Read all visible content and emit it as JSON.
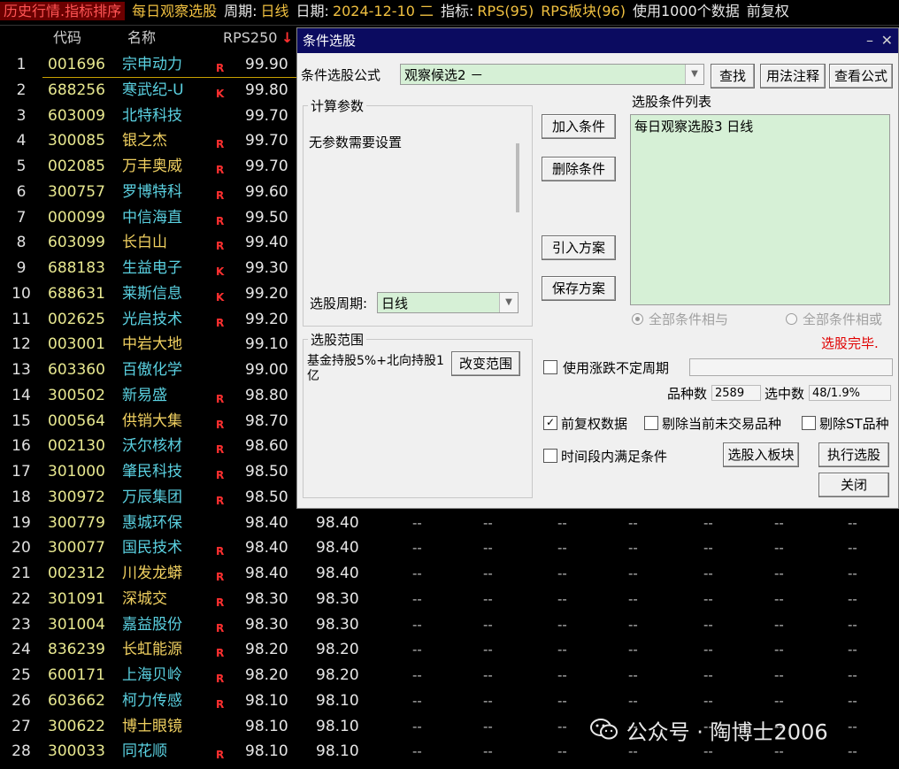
{
  "topbar": {
    "title": "历史行情.指标排序",
    "formula": "每日观察选股",
    "period_label": "周期:",
    "period_value": "日线",
    "date_label": "日期:",
    "date_value": "2024-12-10 二",
    "indicator_label": "指标:",
    "indicator_value": "RPS(95)",
    "sector_value": "RPS板块(96)",
    "data_note": "使用1000个数据",
    "adjust": "前复权"
  },
  "table": {
    "headers": {
      "code": "代码",
      "name": "名称",
      "rps": "RPS250",
      "sort_icon": "↓"
    },
    "rows": [
      {
        "idx": "1",
        "code": "001696",
        "name": "宗申动力",
        "flag": "R",
        "rps": "99.90",
        "rps2": "",
        "name_color": "#5ad0e0"
      },
      {
        "idx": "2",
        "code": "688256",
        "name": "寒武纪-U",
        "flag": "K",
        "rps": "99.80",
        "rps2": "",
        "name_color": "#5ad0e0"
      },
      {
        "idx": "3",
        "code": "603009",
        "name": "北特科技",
        "flag": "",
        "rps": "99.70",
        "rps2": "",
        "name_color": "#5ad0e0"
      },
      {
        "idx": "4",
        "code": "300085",
        "name": "银之杰",
        "flag": "R",
        "rps": "99.70",
        "rps2": "",
        "name_color": "#f0d060"
      },
      {
        "idx": "5",
        "code": "002085",
        "name": "万丰奥威",
        "flag": "R",
        "rps": "99.70",
        "rps2": "",
        "name_color": "#f0d060"
      },
      {
        "idx": "6",
        "code": "300757",
        "name": "罗博特科",
        "flag": "R",
        "rps": "99.60",
        "rps2": "",
        "name_color": "#5ad0e0"
      },
      {
        "idx": "7",
        "code": "000099",
        "name": "中信海直",
        "flag": "R",
        "rps": "99.50",
        "rps2": "",
        "name_color": "#5ad0e0"
      },
      {
        "idx": "8",
        "code": "603099",
        "name": "长白山",
        "flag": "R",
        "rps": "99.40",
        "rps2": "",
        "name_color": "#f0d060"
      },
      {
        "idx": "9",
        "code": "688183",
        "name": "生益电子",
        "flag": "K",
        "rps": "99.30",
        "rps2": "",
        "name_color": "#5ad0e0"
      },
      {
        "idx": "10",
        "code": "688631",
        "name": "莱斯信息",
        "flag": "K",
        "rps": "99.20",
        "rps2": "",
        "name_color": "#5ad0e0"
      },
      {
        "idx": "11",
        "code": "002625",
        "name": "光启技术",
        "flag": "R",
        "rps": "99.20",
        "rps2": "",
        "name_color": "#5ad0e0"
      },
      {
        "idx": "12",
        "code": "003001",
        "name": "中岩大地",
        "flag": "",
        "rps": "99.10",
        "rps2": "",
        "name_color": "#f0d060"
      },
      {
        "idx": "13",
        "code": "603360",
        "name": "百傲化学",
        "flag": "",
        "rps": "99.00",
        "rps2": "",
        "name_color": "#5ad0e0"
      },
      {
        "idx": "14",
        "code": "300502",
        "name": "新易盛",
        "flag": "R",
        "rps": "98.80",
        "rps2": "",
        "name_color": "#5ad0e0"
      },
      {
        "idx": "15",
        "code": "000564",
        "name": "供销大集",
        "flag": "R",
        "rps": "98.70",
        "rps2": "",
        "name_color": "#f0d060"
      },
      {
        "idx": "16",
        "code": "002130",
        "name": "沃尔核材",
        "flag": "R",
        "rps": "98.60",
        "rps2": "",
        "name_color": "#5ad0e0"
      },
      {
        "idx": "17",
        "code": "301000",
        "name": "肇民科技",
        "flag": "R",
        "rps": "98.50",
        "rps2": "",
        "name_color": "#5ad0e0"
      },
      {
        "idx": "18",
        "code": "300972",
        "name": "万辰集团",
        "flag": "R",
        "rps": "98.50",
        "rps2": "",
        "name_color": "#5ad0e0"
      },
      {
        "idx": "19",
        "code": "300779",
        "name": "惠城环保",
        "flag": "",
        "rps": "98.40",
        "rps2": "98.40",
        "name_color": "#5ad0e0"
      },
      {
        "idx": "20",
        "code": "300077",
        "name": "国民技术",
        "flag": "R",
        "rps": "98.40",
        "rps2": "98.40",
        "name_color": "#5ad0e0"
      },
      {
        "idx": "21",
        "code": "002312",
        "name": "川发龙蟒",
        "flag": "R",
        "rps": "98.40",
        "rps2": "98.40",
        "name_color": "#f0d060"
      },
      {
        "idx": "22",
        "code": "301091",
        "name": "深城交",
        "flag": "R",
        "rps": "98.30",
        "rps2": "98.30",
        "name_color": "#f0d060"
      },
      {
        "idx": "23",
        "code": "301004",
        "name": "嘉益股份",
        "flag": "R",
        "rps": "98.30",
        "rps2": "98.30",
        "name_color": "#5ad0e0"
      },
      {
        "idx": "24",
        "code": "836239",
        "name": "长虹能源",
        "flag": "R",
        "rps": "98.20",
        "rps2": "98.20",
        "name_color": "#f0d060"
      },
      {
        "idx": "25",
        "code": "600171",
        "name": "上海贝岭",
        "flag": "R",
        "rps": "98.20",
        "rps2": "98.20",
        "name_color": "#5ad0e0"
      },
      {
        "idx": "26",
        "code": "603662",
        "name": "柯力传感",
        "flag": "R",
        "rps": "98.10",
        "rps2": "98.10",
        "name_color": "#5ad0e0"
      },
      {
        "idx": "27",
        "code": "300622",
        "name": "博士眼镜",
        "flag": "",
        "rps": "98.10",
        "rps2": "98.10",
        "name_color": "#f0d060"
      },
      {
        "idx": "28",
        "code": "300033",
        "name": "同花顺",
        "flag": "R",
        "rps": "98.10",
        "rps2": "98.10",
        "name_color": "#5ad0e0"
      }
    ],
    "dash": "--"
  },
  "dialog": {
    "title": "条件选股",
    "min_icon": "–",
    "close_icon": "✕",
    "formula_label": "条件选股公式",
    "formula_value": "观察候选2  －",
    "find_btn": "查找",
    "usage_btn": "用法注释",
    "view_btn": "查看公式",
    "params_group": "计算参数",
    "params_text": "无参数需要设置",
    "period_label": "选股周期:",
    "period_value": "日线",
    "add_btn": "加入条件",
    "delete_btn": "删除条件",
    "import_btn": "引入方案",
    "save_btn": "保存方案",
    "cond_list_label": "选股条件列表",
    "cond_item": "每日观察选股3  日线",
    "radio_and": "全部条件相与",
    "radio_or": "全部条件相或",
    "status_done": "选股完毕.",
    "range_group": "选股范围",
    "range_text": "基金持股5%+北向持股1亿",
    "change_range_btn": "改变范围",
    "use_updown": "使用涨跌不定周期",
    "count_label": "品种数",
    "count_value": "2589",
    "selected_label": "选中数",
    "selected_value": "48/1.9%",
    "adj_data": "前复权数据",
    "exclude_untraded": "剔除当前未交易品种",
    "exclude_st": "剔除ST品种",
    "time_satisfy": "时间段内满足条件",
    "to_sector_btn": "选股入板块",
    "run_btn": "执行选股",
    "close_btn": "关闭"
  },
  "watermark": {
    "text": "公众号 · 陶博士2006"
  },
  "colors": {
    "flag_red": "#ff3030",
    "code": "#e8e890",
    "dialog_title_bg": "#0b0b60",
    "list_green": "#d6f0d6"
  }
}
